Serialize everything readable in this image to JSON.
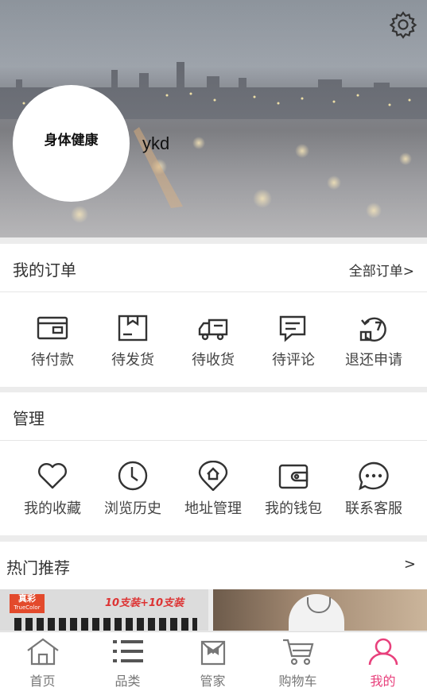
{
  "profile": {
    "avatar_text": "身体健康",
    "username": "ykd"
  },
  "orders": {
    "title": "我的订单",
    "all_link": "全部订单>",
    "items": [
      {
        "label": "待付款",
        "icon": "wallet-icon"
      },
      {
        "label": "待发货",
        "icon": "package-icon"
      },
      {
        "label": "待收货",
        "icon": "truck-icon"
      },
      {
        "label": "待评论",
        "icon": "comment-icon"
      },
      {
        "label": "退还申请",
        "icon": "refund-icon"
      }
    ]
  },
  "manage": {
    "title": "管理",
    "items": [
      {
        "label": "我的收藏",
        "icon": "heart-icon"
      },
      {
        "label": "浏览历史",
        "icon": "clock-icon"
      },
      {
        "label": "地址管理",
        "icon": "location-pin-icon"
      },
      {
        "label": "我的钱包",
        "icon": "purse-icon"
      },
      {
        "label": "联系客服",
        "icon": "chat-bubble-icon"
      }
    ]
  },
  "hot": {
    "title": "热门推荐",
    "arrow": ">"
  },
  "products": [
    {
      "brand": "真彩",
      "brand_sub": "TrueColor",
      "promo": "10支装+10支装"
    },
    {
      "image": "product-photo-man"
    }
  ],
  "tabbar": {
    "items": [
      {
        "label": "首页",
        "icon": "home-icon"
      },
      {
        "label": "品类",
        "icon": "list-icon"
      },
      {
        "label": "管家",
        "icon": "butler-icon"
      },
      {
        "label": "购物车",
        "icon": "cart-icon"
      },
      {
        "label": "我的",
        "icon": "user-icon"
      }
    ],
    "active_color": "#e8407c",
    "inactive_color": "#777777"
  }
}
